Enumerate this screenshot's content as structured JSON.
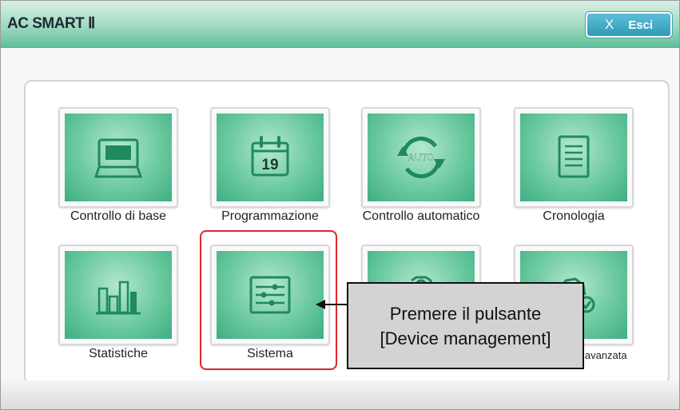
{
  "window": {
    "title": "AC SMART Ⅱ",
    "exit_icon": "X",
    "exit_label": "Esci"
  },
  "tiles": [
    {
      "label": "Controllo di base",
      "icon": "display-icon"
    },
    {
      "label": "Programmazione",
      "icon": "calendar-icon",
      "icon_text": "19"
    },
    {
      "label": "Controllo automatico",
      "icon": "auto-cycle-icon",
      "icon_text": "AUTO"
    },
    {
      "label": "Cronologia",
      "icon": "document-icon"
    },
    {
      "label": "Statistiche",
      "icon": "bar-chart-icon"
    },
    {
      "label": "Sistema",
      "icon": "sliders-icon"
    },
    {
      "label": "",
      "icon": "gear-shield-icon"
    },
    {
      "label": "e avanzata",
      "icon": "gear-check-icon"
    }
  ],
  "annotation": {
    "line1": "Premere il pulsante",
    "line2": "[Device management]"
  },
  "colors": {
    "title_bar": "#9fd9bf",
    "tile_green": "#6ccaa0",
    "icon_dark_green": "#1f8a5c",
    "highlight_red": "#e0252b",
    "exit_button": "#2e9ab8"
  }
}
